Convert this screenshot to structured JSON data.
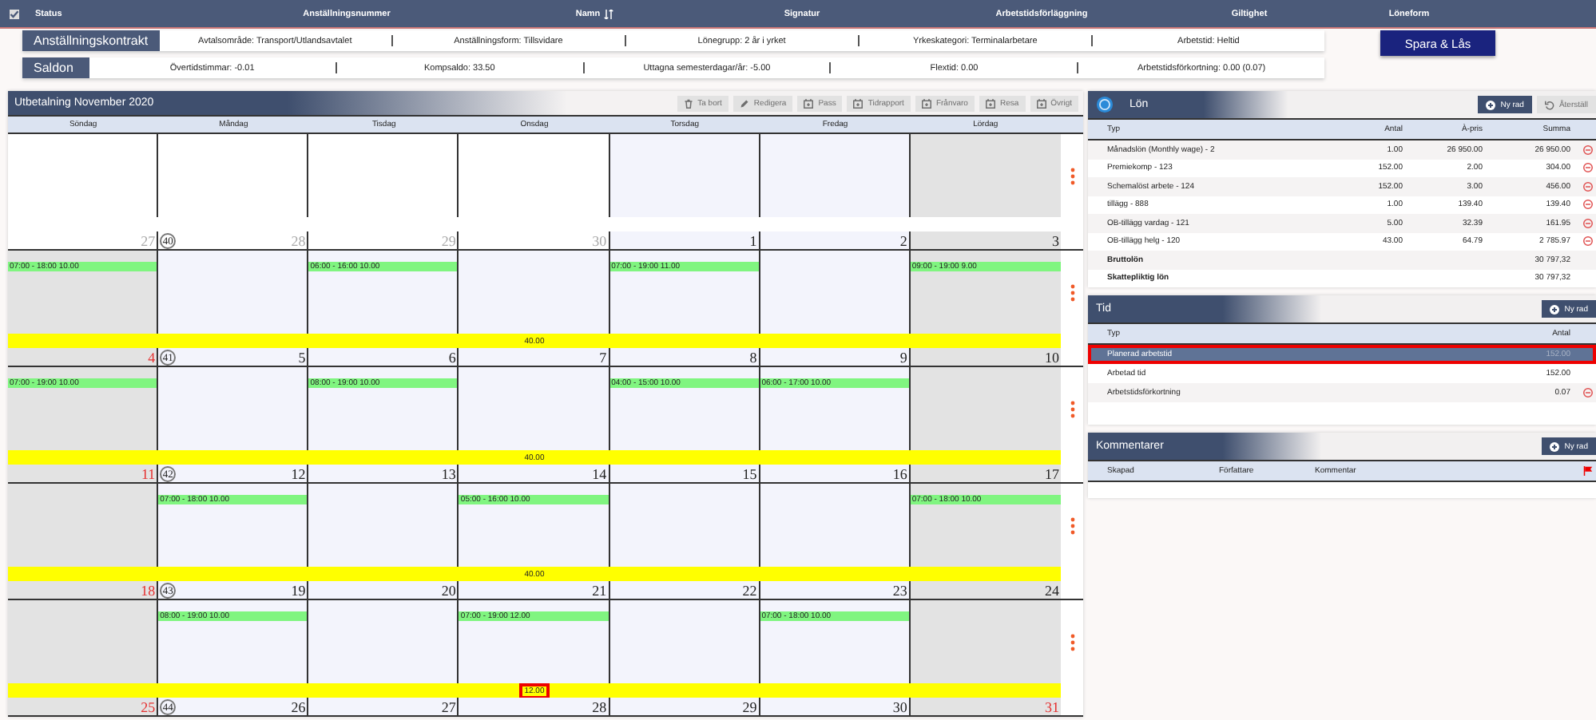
{
  "top_bar": {
    "checked": true,
    "columns": [
      {
        "label": "Status",
        "sortable": false
      },
      {
        "label": "Anställningsnummer",
        "sortable": false
      },
      {
        "label": "Namn",
        "sortable": true
      },
      {
        "label": "Signatur",
        "sortable": false
      },
      {
        "label": "Arbetstidsförläggning",
        "sortable": false
      },
      {
        "label": "Giltighet",
        "sortable": false
      },
      {
        "label": "Löneform",
        "sortable": false
      }
    ]
  },
  "contract": {
    "title": "Anställningskontrakt",
    "items": [
      "Avtalsområde: Transport/Utlandsavtalet",
      "Anställningsform: Tillsvidare",
      "Lönegrupp: 2 år i yrket",
      "Yrkeskategori: Terminalarbetare",
      "Arbetstid: Heltid"
    ]
  },
  "balances": {
    "title": "Saldon",
    "items": [
      "Övertidstimmar: -0.01",
      "Kompsaldo: 33.50",
      "Uttagna semesterdagar/år: -5.00",
      "Flextid: 0.00",
      "Arbetstidsförkortning: 0.00 (0.07)"
    ]
  },
  "save_button": "Spara & Lås",
  "calendar": {
    "title": "Utbetalning November 2020",
    "toolbar": [
      {
        "label": "Ta bort",
        "kind": "delete",
        "disabled": true
      },
      {
        "label": "Redigera",
        "kind": "edit",
        "disabled": true
      },
      {
        "label": "Pass",
        "kind": "calendar",
        "disabled": true
      },
      {
        "label": "Tidrapport",
        "kind": "calendar",
        "disabled": true
      },
      {
        "label": "Frånvaro",
        "kind": "calendar",
        "disabled": true
      },
      {
        "label": "Resa",
        "kind": "calendar",
        "disabled": true
      },
      {
        "label": "Övrigt",
        "kind": "calendar",
        "disabled": true
      }
    ],
    "weekdays": [
      "Söndag",
      "Måndag",
      "Tisdag",
      "Onsdag",
      "Torsdag",
      "Fredag",
      "Lördag"
    ],
    "weeks": [
      {
        "week": "40",
        "days": [
          {
            "day": "27",
            "kind": "outside",
            "other_month": true,
            "holiday": false
          },
          {
            "day": "28",
            "kind": "outside",
            "other_month": true,
            "holiday": false
          },
          {
            "day": "29",
            "kind": "outside",
            "other_month": true,
            "holiday": false
          },
          {
            "day": "30",
            "kind": "outside",
            "other_month": true,
            "holiday": false
          },
          {
            "day": "1",
            "kind": "workday",
            "other_month": false,
            "holiday": false
          },
          {
            "day": "2",
            "kind": "workday",
            "other_month": false,
            "holiday": false
          },
          {
            "day": "3",
            "kind": "weekend",
            "other_month": false,
            "holiday": false
          }
        ]
      },
      {
        "week": "41",
        "total": "40.00",
        "highlighted": false,
        "days": [
          {
            "day": "4",
            "kind": "weekend",
            "other_month": false,
            "holiday": true,
            "shift": "07:00 - 18:00 10.00"
          },
          {
            "day": "5",
            "kind": "workday",
            "other_month": false,
            "holiday": false
          },
          {
            "day": "6",
            "kind": "workday",
            "other_month": false,
            "holiday": false,
            "shift": "06:00 - 16:00 10.00"
          },
          {
            "day": "7",
            "kind": "workday",
            "other_month": false,
            "holiday": false
          },
          {
            "day": "8",
            "kind": "workday",
            "other_month": false,
            "holiday": false,
            "shift": "07:00 - 19:00 11.00"
          },
          {
            "day": "9",
            "kind": "workday",
            "other_month": false,
            "holiday": false
          },
          {
            "day": "10",
            "kind": "weekend",
            "other_month": false,
            "holiday": false,
            "shift": "09:00 - 19:00 9.00"
          }
        ]
      },
      {
        "week": "42",
        "total": "40.00",
        "highlighted": false,
        "days": [
          {
            "day": "11",
            "kind": "weekend",
            "other_month": false,
            "holiday": true,
            "shift": "07:00 - 19:00 10.00"
          },
          {
            "day": "12",
            "kind": "workday",
            "other_month": false,
            "holiday": false
          },
          {
            "day": "13",
            "kind": "workday",
            "other_month": false,
            "holiday": false,
            "shift": "08:00 - 19:00 10.00"
          },
          {
            "day": "14",
            "kind": "workday",
            "other_month": false,
            "holiday": false
          },
          {
            "day": "15",
            "kind": "workday",
            "other_month": false,
            "holiday": false,
            "shift": "04:00 - 15:00 10.00"
          },
          {
            "day": "16",
            "kind": "workday",
            "other_month": false,
            "holiday": false,
            "shift": "06:00 - 17:00 10.00"
          },
          {
            "day": "17",
            "kind": "weekend",
            "other_month": false,
            "holiday": false
          }
        ]
      },
      {
        "week": "43",
        "total": "40.00",
        "highlighted": false,
        "days": [
          {
            "day": "18",
            "kind": "weekend",
            "other_month": false,
            "holiday": true
          },
          {
            "day": "19",
            "kind": "workday",
            "other_month": false,
            "holiday": false,
            "shift": "07:00 - 18:00 10.00"
          },
          {
            "day": "20",
            "kind": "workday",
            "other_month": false,
            "holiday": false
          },
          {
            "day": "21",
            "kind": "workday",
            "other_month": false,
            "holiday": false,
            "shift": "05:00 - 16:00 10.00"
          },
          {
            "day": "22",
            "kind": "workday",
            "other_month": false,
            "holiday": false
          },
          {
            "day": "23",
            "kind": "workday",
            "other_month": false,
            "holiday": false
          },
          {
            "day": "24",
            "kind": "weekend",
            "other_month": false,
            "holiday": false,
            "shift": "07:00 - 18:00 10.00"
          }
        ]
      },
      {
        "week": "44",
        "total": "12.00",
        "highlighted": true,
        "days": [
          {
            "day": "25",
            "kind": "weekend",
            "other_month": false,
            "holiday": true
          },
          {
            "day": "26",
            "kind": "workday",
            "other_month": false,
            "holiday": false,
            "shift": "08:00 - 19:00 10.00"
          },
          {
            "day": "27",
            "kind": "workday",
            "other_month": false,
            "holiday": false
          },
          {
            "day": "28",
            "kind": "workday",
            "other_month": false,
            "holiday": false,
            "shift": "07:00 - 19:00 12.00"
          },
          {
            "day": "29",
            "kind": "workday",
            "other_month": false,
            "holiday": false
          },
          {
            "day": "30",
            "kind": "workday",
            "other_month": false,
            "holiday": false,
            "shift": "07:00 - 18:00 10.00"
          },
          {
            "day": "31",
            "kind": "weekend",
            "other_month": false,
            "holiday": true
          }
        ]
      }
    ]
  },
  "salary": {
    "title": "Lön",
    "buttons": [
      {
        "label": "Ny rad",
        "kind": "add",
        "disabled": false
      },
      {
        "label": "Återställ",
        "kind": "reset",
        "disabled": true
      }
    ],
    "columns": [
      "Typ",
      "Antal",
      "À-pris",
      "Summa"
    ],
    "rows": [
      {
        "kind": "line",
        "type": "Månadslön (Monthly wage) - 2",
        "antal": "1.00",
        "apris": "26 950.00",
        "summa": "26 950.00",
        "removable": true
      },
      {
        "kind": "line",
        "type": "Premiekomp - 123",
        "antal": "152.00",
        "apris": "2.00",
        "summa": "304.00",
        "removable": true
      },
      {
        "kind": "line",
        "type": "Schemalöst arbete - 124",
        "antal": "152.00",
        "apris": "3.00",
        "summa": "456.00",
        "removable": true
      },
      {
        "kind": "line",
        "type": "tillägg - 888",
        "antal": "1.00",
        "apris": "139.40",
        "summa": "139.40",
        "removable": true
      },
      {
        "kind": "line",
        "type": "OB-tillägg vardag - 121",
        "antal": "5.00",
        "apris": "32.39",
        "summa": "161.95",
        "removable": true
      },
      {
        "kind": "line",
        "type": "OB-tillägg helg - 120",
        "antal": "43.00",
        "apris": "64.79",
        "summa": "2 785.97",
        "removable": true
      },
      {
        "kind": "total",
        "type": "Bruttolön",
        "summa": "30 797,32",
        "removable": false
      },
      {
        "kind": "total",
        "type": "Skattepliktig lön",
        "summa": "30 797,32",
        "removable": false
      }
    ]
  },
  "time": {
    "title": "Tid",
    "buttons": [
      {
        "label": "Ny rad",
        "kind": "add",
        "disabled": false
      }
    ],
    "columns": [
      "Typ",
      "Antal"
    ],
    "rows": [
      {
        "type": "Planerad arbetstid",
        "antal": "152.00",
        "selected": true,
        "removable": false
      },
      {
        "type": "Arbetad tid",
        "antal": "152.00",
        "selected": false,
        "removable": false
      },
      {
        "type": "Arbetstidsförkortning",
        "antal": "0.07",
        "selected": false,
        "removable": true
      }
    ]
  },
  "comments": {
    "title": "Kommentarer",
    "buttons": [
      {
        "label": "Ny rad",
        "kind": "add",
        "disabled": false
      }
    ],
    "columns": [
      "Skapad",
      "Författare",
      "Kommentar"
    ]
  }
}
